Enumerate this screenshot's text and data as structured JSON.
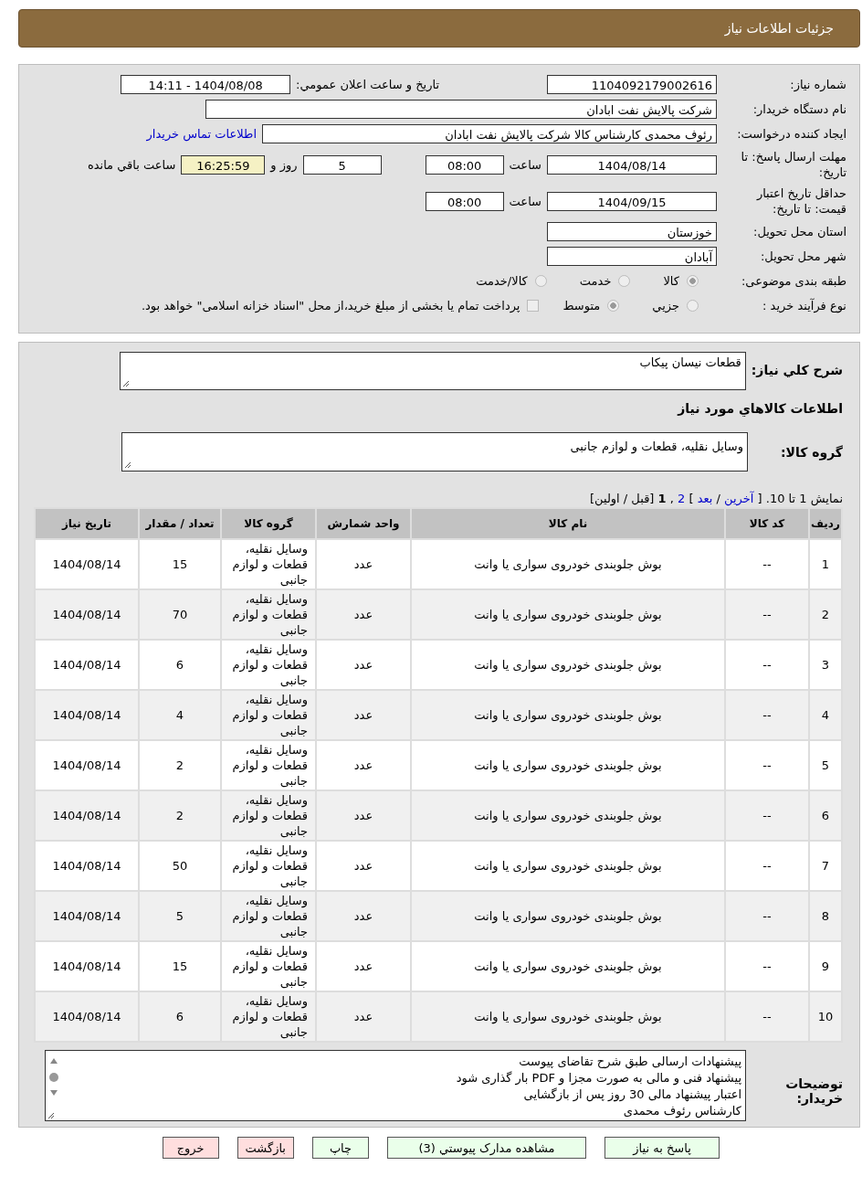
{
  "header": {
    "title": "جزئیات اطلاعات نیاز"
  },
  "form": {
    "need_number": {
      "label": "شماره نیاز:",
      "value": "1104092179002616"
    },
    "announce": {
      "label": "تاريخ و ساعت اعلان عمومي:",
      "value": "1404/08/08 - 14:11"
    },
    "buyer": {
      "label": "نام دستگاه خريدار:",
      "value": "شرکت پالايش نفت ابادان"
    },
    "creator": {
      "label": "ايجاد کننده درخواست:",
      "value": "رئوف محمدی کارشناس کالا شرکت پالایش نفت ابادان",
      "link": "اطلاعات تماس خريدار"
    },
    "deadline": {
      "label": "مهلت ارسال پاسخ: تا تاریخ:",
      "date": "1404/08/14",
      "time_label": "ساعت",
      "time": "08:00",
      "days": "5",
      "days_label": "روز و",
      "remaining": "16:25:59",
      "remaining_label": "ساعت باقي مانده"
    },
    "validity": {
      "label": "حداقل تاریخ اعتبار قیمت: تا تاریخ:",
      "date": "1404/09/15",
      "time_label": "ساعت",
      "time": "08:00"
    },
    "province": {
      "label": "استان محل تحویل:",
      "value": "خوزستان"
    },
    "city": {
      "label": "شهر محل تحویل:",
      "value": "آبادان"
    },
    "category": {
      "label": "طبقه بندی موضوعی:",
      "options": [
        {
          "label": "کالا",
          "selected": true
        },
        {
          "label": "خدمت",
          "selected": false
        },
        {
          "label": "کالا/خدمت",
          "selected": false
        }
      ]
    },
    "process": {
      "label": "نوع فرآیند خرید :",
      "options": [
        {
          "label": "جزيي",
          "selected": false
        },
        {
          "label": "متوسط",
          "selected": true
        }
      ],
      "payment": {
        "checked": false,
        "text": "پرداخت تمام یا بخشی از مبلغ خرید،از محل \"اسناد خزانه اسلامی\" خواهد بود."
      }
    }
  },
  "details": {
    "description": {
      "label": "شرح کلي نياز:",
      "value": "قطعات نیسان پیکاب"
    },
    "goods_title": "اطلاعات کالاهاي مورد نياز",
    "group": {
      "label": "گروه کالا:",
      "value": "وسایل نقلیه، قطعات و لوازم جانبی"
    },
    "pagination": [
      {
        "kind": "text",
        "text": "نمایش 1 تا 10. ["
      },
      {
        "kind": "link",
        "text": "آخرین"
      },
      {
        "kind": "text",
        "text": "/"
      },
      {
        "kind": "link",
        "text": "بعد"
      },
      {
        "kind": "text",
        "text": "]"
      },
      {
        "kind": "link",
        "text": "2"
      },
      {
        "kind": "text",
        "text": ","
      },
      {
        "kind": "current",
        "text": "1"
      },
      {
        "kind": "text",
        "text": "[قبل / اولین]"
      }
    ],
    "table": {
      "columns": [
        "رديف",
        "کد کالا",
        "نام کالا",
        "واحد شمارش",
        "گروه کالا",
        "تعداد / مقدار",
        "تاريخ نياز"
      ],
      "rows": [
        [
          "1",
          "--",
          "بوش جلوبندی خودروی سواری یا وانت",
          "عدد",
          "وسایل نقلیه، قطعات و لوازم جانبی",
          "15",
          "1404/08/14"
        ],
        [
          "2",
          "--",
          "بوش جلوبندی خودروی سواری یا وانت",
          "عدد",
          "وسایل نقلیه، قطعات و لوازم جانبی",
          "70",
          "1404/08/14"
        ],
        [
          "3",
          "--",
          "بوش جلوبندی خودروی سواری یا وانت",
          "عدد",
          "وسایل نقلیه، قطعات و لوازم جانبی",
          "6",
          "1404/08/14"
        ],
        [
          "4",
          "--",
          "بوش جلوبندی خودروی سواری یا وانت",
          "عدد",
          "وسایل نقلیه، قطعات و لوازم جانبی",
          "4",
          "1404/08/14"
        ],
        [
          "5",
          "--",
          "بوش جلوبندی خودروی سواری یا وانت",
          "عدد",
          "وسایل نقلیه، قطعات و لوازم جانبی",
          "2",
          "1404/08/14"
        ],
        [
          "6",
          "--",
          "بوش جلوبندی خودروی سواری یا وانت",
          "عدد",
          "وسایل نقلیه، قطعات و لوازم جانبی",
          "2",
          "1404/08/14"
        ],
        [
          "7",
          "--",
          "بوش جلوبندی خودروی سواری یا وانت",
          "عدد",
          "وسایل نقلیه، قطعات و لوازم جانبی",
          "50",
          "1404/08/14"
        ],
        [
          "8",
          "--",
          "بوش جلوبندی خودروی سواری یا وانت",
          "عدد",
          "وسایل نقلیه، قطعات و لوازم جانبی",
          "5",
          "1404/08/14"
        ],
        [
          "9",
          "--",
          "بوش جلوبندی خودروی سواری یا وانت",
          "عدد",
          "وسایل نقلیه، قطعات و لوازم جانبی",
          "15",
          "1404/08/14"
        ],
        [
          "10",
          "--",
          "بوش جلوبندی خودروی سواری یا وانت",
          "عدد",
          "وسایل نقلیه، قطعات و لوازم جانبی",
          "6",
          "1404/08/14"
        ]
      ]
    },
    "notes": {
      "label": "توضیحات خریدار:",
      "lines": [
        "پیشنهادات ارسالی طبق شرح تقاضای پیوست",
        "پیشنهاد فنی و مالی به صورت مجزا و PDF بار گذاری شود",
        "اعتبار پیشنهاد مالی 30 روز پس از بازگشایی",
        "کارشناس رئوف  محمدی"
      ]
    }
  },
  "buttons": [
    {
      "label": "پاسخ به نیاز",
      "color": "#eaffea"
    },
    {
      "label": "مشاهده مدارک پیوستي (3)",
      "color": "#eaffea"
    },
    {
      "label": "چاپ",
      "color": "#eaffea"
    },
    {
      "label": "بازگشت",
      "color": "#ffdede"
    },
    {
      "label": "خروج",
      "color": "#ffdede"
    }
  ]
}
